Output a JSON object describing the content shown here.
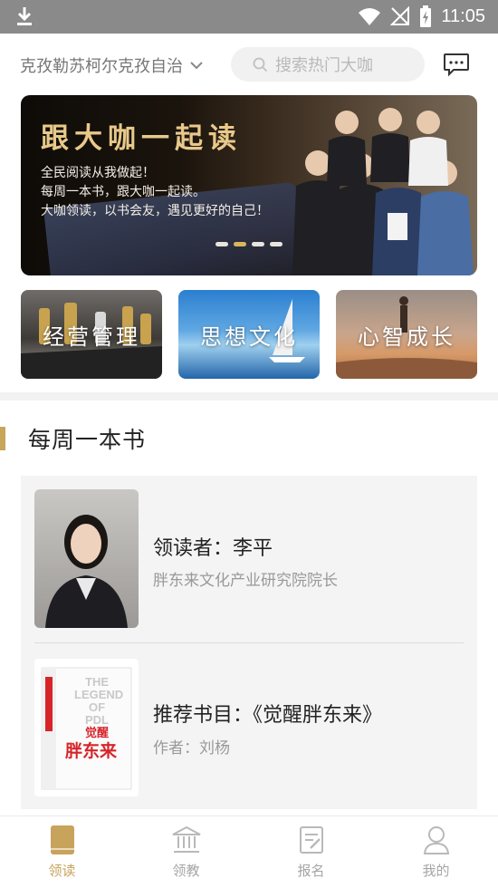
{
  "status_bar": {
    "time": "11:05"
  },
  "header": {
    "location": "克孜勒苏柯尔克孜自治",
    "search_placeholder": "搜索热门大咖"
  },
  "banner": {
    "title": "跟大咖一起读",
    "lines": [
      "全民阅读从我做起！",
      "每周一本书，跟大咖一起读。",
      "大咖领读，以书会友，遇见更好的自己！"
    ],
    "page_count": 4,
    "active_page": 2
  },
  "categories": [
    {
      "label": "经营管理"
    },
    {
      "label": "思想文化"
    },
    {
      "label": "心智成长"
    }
  ],
  "section": {
    "title": "每周一本书",
    "accent_color": "#c9a55c"
  },
  "weekly": {
    "reader": "领读者：李平",
    "reader_title": "胖东来文化产业研究院院长",
    "recommended": "推荐书目：《觉醒胖东来》",
    "author": "作者：刘杨",
    "cover_text": {
      "en_line1": "THE",
      "en_line2": "LEGEND",
      "en_line3": "OF",
      "en_line4": "PDL",
      "cn_line1": "觉醒",
      "cn_line2": "胖东来"
    }
  },
  "tabs": [
    {
      "label": "领读",
      "icon": "book-icon",
      "active": true
    },
    {
      "label": "领教",
      "icon": "institution-icon",
      "active": false
    },
    {
      "label": "报名",
      "icon": "signup-form-icon",
      "active": false
    },
    {
      "label": "我的",
      "icon": "user-icon",
      "active": false
    }
  ],
  "colors": {
    "accent": "#c9a55c",
    "status_bar": "#8a8a8a"
  }
}
